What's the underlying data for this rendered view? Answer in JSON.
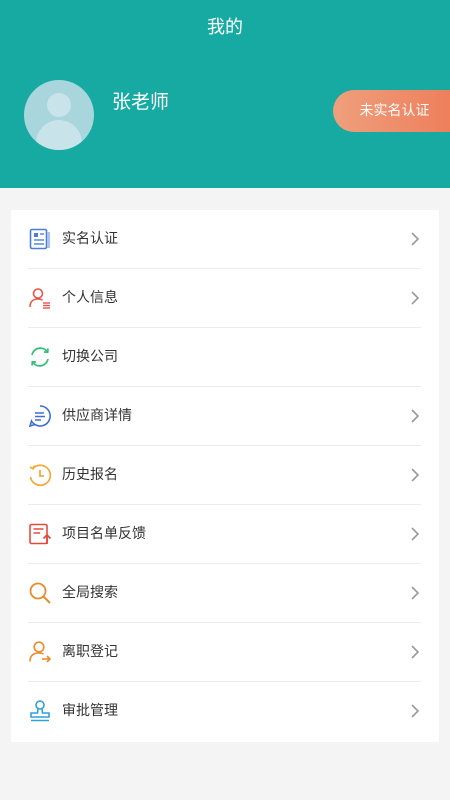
{
  "header": {
    "title": "我的",
    "username": "张老师",
    "verify_button_label": "未实名认证"
  },
  "menu": {
    "items": [
      {
        "label": "实名认证",
        "icon": "id-card-icon",
        "color": "#4a7fd8",
        "has_chevron": true
      },
      {
        "label": "个人信息",
        "icon": "user-info-icon",
        "color": "#e3564a",
        "has_chevron": true
      },
      {
        "label": "切换公司",
        "icon": "switch-icon",
        "color": "#34c07a",
        "has_chevron": false
      },
      {
        "label": "供应商详情",
        "icon": "message-icon",
        "color": "#3c6fd6",
        "has_chevron": true
      },
      {
        "label": "历史报名",
        "icon": "history-clock-icon",
        "color": "#f1a935",
        "has_chevron": true
      },
      {
        "label": "项目名单反馈",
        "icon": "feedback-list-icon",
        "color": "#e44b3c",
        "has_chevron": true
      },
      {
        "label": "全局搜索",
        "icon": "search-icon",
        "color": "#e98a2c",
        "has_chevron": true
      },
      {
        "label": "离职登记",
        "icon": "resign-user-icon",
        "color": "#ef8a2c",
        "has_chevron": true
      },
      {
        "label": "审批管理",
        "icon": "approval-stamp-icon",
        "color": "#2fa1d8",
        "has_chevron": true
      }
    ]
  },
  "colors": {
    "header_bg": "#17aaa2",
    "verify_button_start": "#ef9f7c",
    "verify_button_end": "#ee7f5c",
    "chevron": "#9a9a9a"
  }
}
